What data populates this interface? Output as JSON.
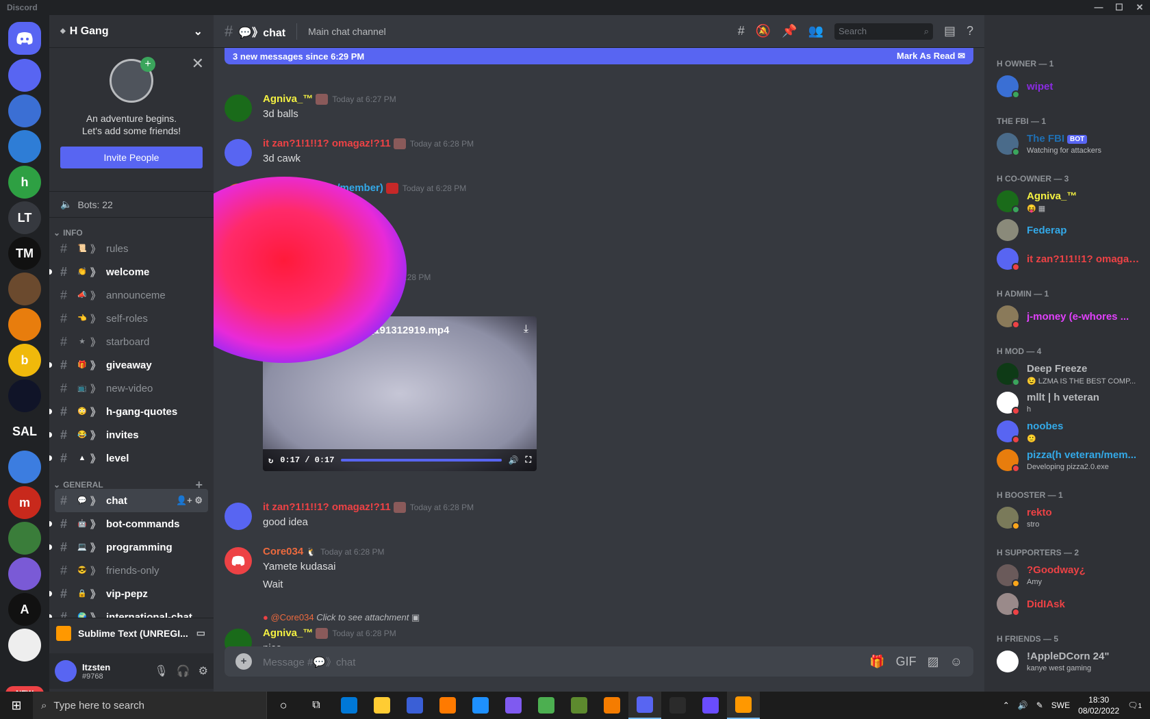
{
  "window": {
    "title": "Discord",
    "minimize": "—",
    "maximize": "☐",
    "close": "✕"
  },
  "servers": [
    {
      "label": "",
      "color": "#5865f2"
    },
    {
      "label": "",
      "color": "#3b6fd4"
    },
    {
      "label": "",
      "color": "#2e7dd6"
    },
    {
      "label": "h",
      "color": "#2ea043"
    },
    {
      "label": "LT",
      "color": "#36393f"
    },
    {
      "label": "TM",
      "color": "#111111"
    },
    {
      "label": "",
      "color": "#6b4a2e"
    },
    {
      "label": "",
      "color": "#e87d0d"
    },
    {
      "label": "b",
      "color": "#f0b90b"
    },
    {
      "label": "",
      "color": "#101428"
    },
    {
      "label": "SAL",
      "color": "#202225"
    },
    {
      "label": "",
      "color": "#3c7de0"
    },
    {
      "label": "m",
      "color": "#c8291c"
    },
    {
      "label": "",
      "color": "#3a7d3a"
    },
    {
      "label": "",
      "color": "#7a5ad6"
    },
    {
      "label": "A",
      "color": "#111111"
    },
    {
      "label": "",
      "color": "#eeeeee"
    }
  ],
  "new_badge": "NEW",
  "guild": {
    "name": "H Gang",
    "invite_text_1": "An adventure begins.",
    "invite_text_2": "Let's add some friends!",
    "invite_button": "Invite People",
    "bots": "Bots: 22"
  },
  "categories": {
    "info": "INFO",
    "general": "GENERAL"
  },
  "info_channels": [
    {
      "name": "rules",
      "emoji": "📜",
      "unread": false
    },
    {
      "name": "welcome",
      "emoji": "👏",
      "unread": true
    },
    {
      "name": "announceme",
      "emoji": "📣",
      "unread": false
    },
    {
      "name": "self-roles",
      "emoji": "👈",
      "unread": false
    },
    {
      "name": "starboard",
      "emoji": "★",
      "unread": false
    },
    {
      "name": "giveaway",
      "emoji": "🎁",
      "unread": true
    },
    {
      "name": "new-video",
      "emoji": "📺",
      "unread": false
    },
    {
      "name": "h-gang-quotes",
      "emoji": "😳",
      "unread": true
    },
    {
      "name": "invites",
      "emoji": "😂",
      "unread": true
    },
    {
      "name": "level",
      "emoji": "▲",
      "unread": true
    }
  ],
  "general_channels": [
    {
      "name": "chat",
      "emoji": "💬",
      "unread": true
    },
    {
      "name": "bot-commands",
      "emoji": "🤖",
      "unread": true
    },
    {
      "name": "programming",
      "emoji": "💻",
      "unread": true
    },
    {
      "name": "friends-only",
      "emoji": "😎",
      "unread": false
    },
    {
      "name": "vip-pepz",
      "emoji": "🔒",
      "unread": true
    },
    {
      "name": "international-chat",
      "emoji": "🌍",
      "unread": true
    }
  ],
  "activity": "Sublime Text (UNREGI...",
  "user": {
    "name": "Itzsten",
    "tag": "#9768"
  },
  "channel": {
    "name": "chat",
    "prefix": "💬》",
    "topic": "Main chat channel",
    "search_placeholder": "Search",
    "new_messages": "3 new messages since 6:29 PM",
    "mark_read": "Mark As Read"
  },
  "messages": [
    {
      "author": "Agniva_™",
      "color": "#f5f242",
      "time": "Today at 6:27 PM",
      "text": "3d balls"
    },
    {
      "author": "it zan?1!1!!1? omagaz!?11",
      "color": "#ed4245",
      "time": "Today at 6:28 PM",
      "text": "3d cawk"
    },
    {
      "author": "pizza(h veteran/member)",
      "color": "#33a9e8",
      "time": "Today at 6:28 PM",
      "text": ""
    },
    {
      "author": "",
      "color": "#dcddde",
      "time": "Today at 6:28 PM",
      "text": ""
    },
    {
      "author": "it zan?1!1!!1? omagaz!?11",
      "color": "#ed4245",
      "time": "Today at 6:28 PM",
      "text": "good idea"
    },
    {
      "author": "Core034",
      "color": "#ed6a3e",
      "time": "Today at 6:28 PM",
      "text": "Yamete kudasai",
      "text2": "Wait"
    },
    {
      "author": "Agniva_™",
      "color": "#f5f242",
      "time": "Today at 6:28 PM",
      "text": "nice",
      "reply_user": "@Core034",
      "reply_text": "Click to see attachment"
    }
  ],
  "video": {
    "filename": "_191312919.mp4",
    "time": "0:17 / 0:17",
    "progress": 1.0
  },
  "composer": {
    "placeholder": "Message #💬》chat"
  },
  "members": {
    "groups": [
      {
        "title": "H OWNER — 1",
        "items": [
          {
            "name": "wipet",
            "color": "#8a2be2",
            "sub": "",
            "status": "#3ba55c",
            "av": "#3a6fd4"
          }
        ]
      },
      {
        "title": "THE FBI — 1",
        "items": [
          {
            "name": "The FBI",
            "color": "#1f6fb2",
            "bot": "BOT",
            "sub": "Watching for attackers",
            "status": "#3ba55c",
            "av": "#4a6b8a"
          }
        ]
      },
      {
        "title": "H CO-OWNER — 3",
        "items": [
          {
            "name": "Agniva_™",
            "color": "#f5f242",
            "sub": "😝 ▦",
            "status": "#3ba55c",
            "av": "#1a6b1a"
          },
          {
            "name": "Federap",
            "color": "#33a9e8",
            "sub": "",
            "status": "",
            "av": "#8a8a7a"
          },
          {
            "name": "it zan?1!1!!1? omagaz!?11",
            "color": "#ed4245",
            "sub": "",
            "status": "#ed4245",
            "av": "#5865f2"
          }
        ]
      },
      {
        "title": "H ADMIN — 1",
        "items": [
          {
            "name": "j-money (e-whores ...",
            "color": "#e040fb",
            "sub": "",
            "status": "#ed4245",
            "av": "#8a7a5a"
          }
        ]
      },
      {
        "title": "H MOD — 4",
        "items": [
          {
            "name": "Deep Freeze",
            "color": "#b9bbbe",
            "sub": "😉 LZMA IS THE BEST COMP...",
            "status": "#3ba55c",
            "av": "#0e3a16"
          },
          {
            "name": "mllt | h veteran",
            "color": "#b9bbbe",
            "sub": "h",
            "status": "#ed4245",
            "av": "#ffffff"
          },
          {
            "name": "noobes",
            "color": "#33a9e8",
            "sub": "🙂",
            "status": "#ed4245",
            "av": "#5865f2"
          },
          {
            "name": "pizza(h veteran/mem...",
            "color": "#33a9e8",
            "sub": "Developing pizza2.0.exe",
            "status": "#ed4245",
            "av": "#e87d0d"
          }
        ]
      },
      {
        "title": "H BOOSTER — 1",
        "items": [
          {
            "name": "rekto",
            "color": "#ed4245",
            "sub": "stro",
            "status": "#faa61a",
            "av": "#7a7a5a"
          }
        ]
      },
      {
        "title": "H SUPPORTERS — 2",
        "items": [
          {
            "name": "?Goodway¿",
            "color": "#ed4245",
            "sub": "Amy",
            "status": "#faa61a",
            "av": "#6a5a5a"
          },
          {
            "name": "DidIAsk",
            "color": "#ed4245",
            "sub": "",
            "status": "#ed4245",
            "av": "#9a8a8a"
          }
        ]
      },
      {
        "title": "H FRIENDS — 5",
        "items": [
          {
            "name": "!AppleDCorn 24\"",
            "color": "#b9bbbe",
            "sub": "kanye west gaming",
            "status": "",
            "av": "#ffffff"
          }
        ]
      }
    ]
  },
  "taskbar": {
    "search_placeholder": "Type here to search",
    "apps": [
      "#0078d7",
      "#ffcc33",
      "#3a5fd6",
      "#ff7a00",
      "#1e90ff",
      "#7f5af0",
      "#4caf50",
      "#5d8a2e",
      "#f57c00",
      "#5865f2",
      "#2b2b2b",
      "#6a4cff",
      "#ff9800"
    ],
    "lang": "SWE",
    "time": "18:30",
    "date": "08/02/2022",
    "notif": "1"
  }
}
